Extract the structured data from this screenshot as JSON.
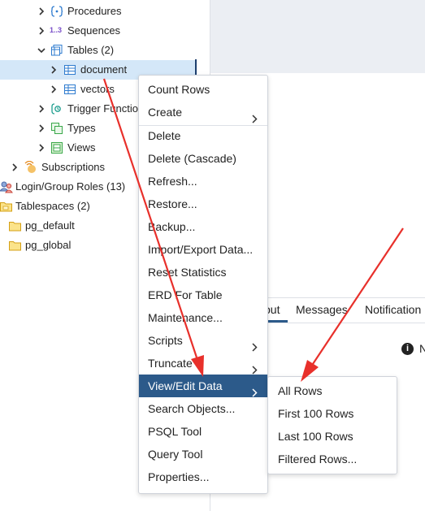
{
  "tree": {
    "items": [
      {
        "label": "Procedures",
        "icon": "procedures-icon"
      },
      {
        "label": "Sequences",
        "icon": "sequences-icon"
      },
      {
        "label": "Tables (2)",
        "icon": "tables-icon"
      },
      {
        "label": "document",
        "icon": "table-icon"
      },
      {
        "label": "vectors",
        "icon": "table-icon"
      },
      {
        "label": "Trigger Functio",
        "icon": "trigger-functions-icon"
      },
      {
        "label": "Types",
        "icon": "types-icon"
      },
      {
        "label": "Views",
        "icon": "views-icon"
      },
      {
        "label": "Subscriptions",
        "icon": "subscriptions-icon"
      },
      {
        "label": "Login/Group Roles (13)",
        "icon": "login-roles-icon"
      },
      {
        "label": "Tablespaces (2)",
        "icon": "tablespaces-icon"
      },
      {
        "label": "pg_default",
        "icon": "folder-icon"
      },
      {
        "label": "pg_global",
        "icon": "folder-icon"
      }
    ],
    "sequences_icon_text": "1..3"
  },
  "context_menu": {
    "items": [
      {
        "label": "Count Rows"
      },
      {
        "label": "Create"
      },
      {
        "label": "Delete"
      },
      {
        "label": "Delete (Cascade)"
      },
      {
        "label": "Refresh..."
      },
      {
        "label": "Restore..."
      },
      {
        "label": "Backup..."
      },
      {
        "label": "Import/Export Data..."
      },
      {
        "label": "Reset Statistics"
      },
      {
        "label": "ERD For Table"
      },
      {
        "label": "Maintenance..."
      },
      {
        "label": "Scripts"
      },
      {
        "label": "Truncate"
      },
      {
        "label": "View/Edit Data"
      },
      {
        "label": "Search Objects..."
      },
      {
        "label": "PSQL Tool"
      },
      {
        "label": "Query Tool"
      },
      {
        "label": "Properties..."
      }
    ]
  },
  "submenu": {
    "items": [
      {
        "label": "All Rows"
      },
      {
        "label": "First 100 Rows"
      },
      {
        "label": "Last 100 Rows"
      },
      {
        "label": "Filtered Rows..."
      }
    ]
  },
  "output_tabs": {
    "tabs": [
      {
        "label": "put"
      },
      {
        "label": "Messages"
      },
      {
        "label": "Notification"
      }
    ],
    "info_text": "N"
  },
  "colors": {
    "accent": "#2c5a8a",
    "selected_row": "#d4e7f8",
    "annotation_arrow": "#e8302b"
  }
}
